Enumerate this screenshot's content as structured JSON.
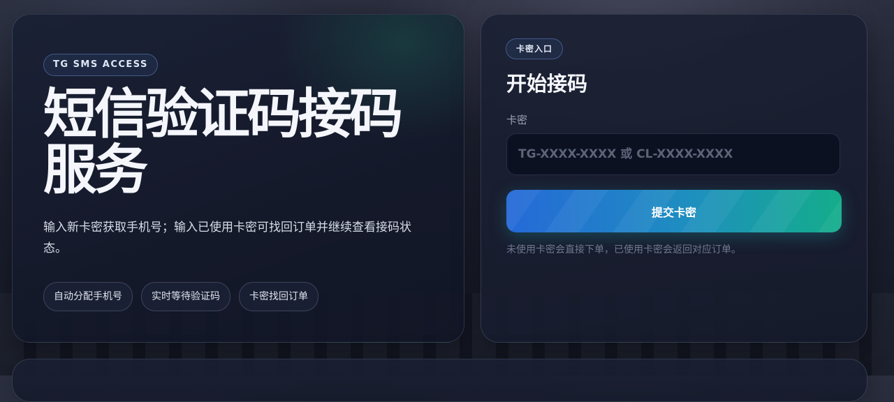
{
  "hero": {
    "badge": "TG SMS ACCESS",
    "title": "短信验证码接码服务",
    "description": "输入新卡密获取手机号；输入已使用卡密可找回订单并继续查看接码状态。",
    "chips": [
      "自动分配手机号",
      "实时等待验证码",
      "卡密找回订单"
    ]
  },
  "entry": {
    "badge": "卡密入口",
    "title": "开始接码",
    "field_label": "卡密",
    "input_value": "",
    "input_placeholder": "TG-XXXX-XXXX 或 CL-XXXX-XXXX",
    "submit_label": "提交卡密",
    "hint": "未使用卡密会直接下单，已使用卡密会返回对应订单。"
  },
  "colors": {
    "accent_start": "#2569d8",
    "accent_end": "#14ad8a",
    "input_bg": "#0c1122"
  }
}
